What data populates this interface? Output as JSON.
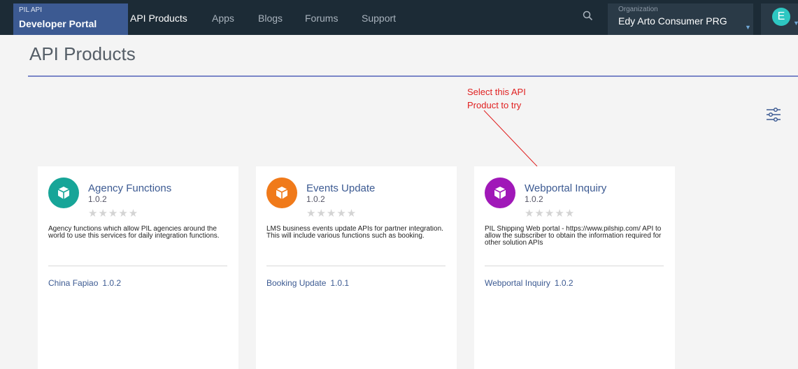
{
  "brand": {
    "small": "PIL API",
    "title": "Developer Portal"
  },
  "nav": [
    {
      "label": "API Products",
      "active": true
    },
    {
      "label": "Apps"
    },
    {
      "label": "Blogs"
    },
    {
      "label": "Forums"
    },
    {
      "label": "Support"
    }
  ],
  "org": {
    "label": "Organization",
    "value": "Edy Arto Consumer PRG"
  },
  "avatar": {
    "initial": "E"
  },
  "page": {
    "title": "API Products"
  },
  "annotation": {
    "line1": "Select this API",
    "line2": "Product to try"
  },
  "cards": [
    {
      "name": "Agency Functions",
      "version": "1.0.2",
      "stars": "★★★★★",
      "rating": 0,
      "description": "Agency functions which allow PIL agencies around the world to use this services for daily integration functions.",
      "plan_name": "China Fapiao",
      "plan_version": "1.0.2",
      "color": "#17a598"
    },
    {
      "name": "Events Update",
      "version": "1.0.2",
      "stars": "★★★★★",
      "rating": 0,
      "description": "LMS business events update APIs for partner integration. This will include various functions such as booking.",
      "plan_name": "Booking Update",
      "plan_version": "1.0.1",
      "color": "#f07a1a"
    },
    {
      "name": "Webportal Inquiry",
      "version": "1.0.2",
      "stars": "★★★★★",
      "rating": 0,
      "description": "PIL Shipping Web portal - https://www.pilship.com/ API to allow the subscriber to obtain the information required for other solution APIs",
      "plan_name": "Webportal Inquiry",
      "plan_version": "1.0.2",
      "color": "#a018b8"
    }
  ],
  "colors": {
    "nav_bg": "#1c2b36",
    "brand_bg": "#3c5a92",
    "link": "#3c5a92",
    "annotation": "#e02020"
  }
}
